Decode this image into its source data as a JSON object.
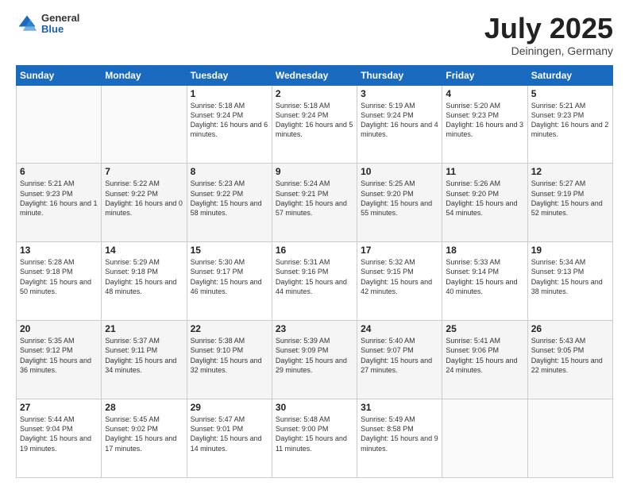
{
  "header": {
    "logo_general": "General",
    "logo_blue": "Blue",
    "month_title": "July 2025",
    "location": "Deiningen, Germany"
  },
  "days_of_week": [
    "Sunday",
    "Monday",
    "Tuesday",
    "Wednesday",
    "Thursday",
    "Friday",
    "Saturday"
  ],
  "weeks": [
    [
      {
        "day": "",
        "sunrise": "",
        "sunset": "",
        "daylight": ""
      },
      {
        "day": "",
        "sunrise": "",
        "sunset": "",
        "daylight": ""
      },
      {
        "day": "1",
        "sunrise": "Sunrise: 5:18 AM",
        "sunset": "Sunset: 9:24 PM",
        "daylight": "Daylight: 16 hours and 6 minutes."
      },
      {
        "day": "2",
        "sunrise": "Sunrise: 5:18 AM",
        "sunset": "Sunset: 9:24 PM",
        "daylight": "Daylight: 16 hours and 5 minutes."
      },
      {
        "day": "3",
        "sunrise": "Sunrise: 5:19 AM",
        "sunset": "Sunset: 9:24 PM",
        "daylight": "Daylight: 16 hours and 4 minutes."
      },
      {
        "day": "4",
        "sunrise": "Sunrise: 5:20 AM",
        "sunset": "Sunset: 9:23 PM",
        "daylight": "Daylight: 16 hours and 3 minutes."
      },
      {
        "day": "5",
        "sunrise": "Sunrise: 5:21 AM",
        "sunset": "Sunset: 9:23 PM",
        "daylight": "Daylight: 16 hours and 2 minutes."
      }
    ],
    [
      {
        "day": "6",
        "sunrise": "Sunrise: 5:21 AM",
        "sunset": "Sunset: 9:23 PM",
        "daylight": "Daylight: 16 hours and 1 minute."
      },
      {
        "day": "7",
        "sunrise": "Sunrise: 5:22 AM",
        "sunset": "Sunset: 9:22 PM",
        "daylight": "Daylight: 16 hours and 0 minutes."
      },
      {
        "day": "8",
        "sunrise": "Sunrise: 5:23 AM",
        "sunset": "Sunset: 9:22 PM",
        "daylight": "Daylight: 15 hours and 58 minutes."
      },
      {
        "day": "9",
        "sunrise": "Sunrise: 5:24 AM",
        "sunset": "Sunset: 9:21 PM",
        "daylight": "Daylight: 15 hours and 57 minutes."
      },
      {
        "day": "10",
        "sunrise": "Sunrise: 5:25 AM",
        "sunset": "Sunset: 9:20 PM",
        "daylight": "Daylight: 15 hours and 55 minutes."
      },
      {
        "day": "11",
        "sunrise": "Sunrise: 5:26 AM",
        "sunset": "Sunset: 9:20 PM",
        "daylight": "Daylight: 15 hours and 54 minutes."
      },
      {
        "day": "12",
        "sunrise": "Sunrise: 5:27 AM",
        "sunset": "Sunset: 9:19 PM",
        "daylight": "Daylight: 15 hours and 52 minutes."
      }
    ],
    [
      {
        "day": "13",
        "sunrise": "Sunrise: 5:28 AM",
        "sunset": "Sunset: 9:18 PM",
        "daylight": "Daylight: 15 hours and 50 minutes."
      },
      {
        "day": "14",
        "sunrise": "Sunrise: 5:29 AM",
        "sunset": "Sunset: 9:18 PM",
        "daylight": "Daylight: 15 hours and 48 minutes."
      },
      {
        "day": "15",
        "sunrise": "Sunrise: 5:30 AM",
        "sunset": "Sunset: 9:17 PM",
        "daylight": "Daylight: 15 hours and 46 minutes."
      },
      {
        "day": "16",
        "sunrise": "Sunrise: 5:31 AM",
        "sunset": "Sunset: 9:16 PM",
        "daylight": "Daylight: 15 hours and 44 minutes."
      },
      {
        "day": "17",
        "sunrise": "Sunrise: 5:32 AM",
        "sunset": "Sunset: 9:15 PM",
        "daylight": "Daylight: 15 hours and 42 minutes."
      },
      {
        "day": "18",
        "sunrise": "Sunrise: 5:33 AM",
        "sunset": "Sunset: 9:14 PM",
        "daylight": "Daylight: 15 hours and 40 minutes."
      },
      {
        "day": "19",
        "sunrise": "Sunrise: 5:34 AM",
        "sunset": "Sunset: 9:13 PM",
        "daylight": "Daylight: 15 hours and 38 minutes."
      }
    ],
    [
      {
        "day": "20",
        "sunrise": "Sunrise: 5:35 AM",
        "sunset": "Sunset: 9:12 PM",
        "daylight": "Daylight: 15 hours and 36 minutes."
      },
      {
        "day": "21",
        "sunrise": "Sunrise: 5:37 AM",
        "sunset": "Sunset: 9:11 PM",
        "daylight": "Daylight: 15 hours and 34 minutes."
      },
      {
        "day": "22",
        "sunrise": "Sunrise: 5:38 AM",
        "sunset": "Sunset: 9:10 PM",
        "daylight": "Daylight: 15 hours and 32 minutes."
      },
      {
        "day": "23",
        "sunrise": "Sunrise: 5:39 AM",
        "sunset": "Sunset: 9:09 PM",
        "daylight": "Daylight: 15 hours and 29 minutes."
      },
      {
        "day": "24",
        "sunrise": "Sunrise: 5:40 AM",
        "sunset": "Sunset: 9:07 PM",
        "daylight": "Daylight: 15 hours and 27 minutes."
      },
      {
        "day": "25",
        "sunrise": "Sunrise: 5:41 AM",
        "sunset": "Sunset: 9:06 PM",
        "daylight": "Daylight: 15 hours and 24 minutes."
      },
      {
        "day": "26",
        "sunrise": "Sunrise: 5:43 AM",
        "sunset": "Sunset: 9:05 PM",
        "daylight": "Daylight: 15 hours and 22 minutes."
      }
    ],
    [
      {
        "day": "27",
        "sunrise": "Sunrise: 5:44 AM",
        "sunset": "Sunset: 9:04 PM",
        "daylight": "Daylight: 15 hours and 19 minutes."
      },
      {
        "day": "28",
        "sunrise": "Sunrise: 5:45 AM",
        "sunset": "Sunset: 9:02 PM",
        "daylight": "Daylight: 15 hours and 17 minutes."
      },
      {
        "day": "29",
        "sunrise": "Sunrise: 5:47 AM",
        "sunset": "Sunset: 9:01 PM",
        "daylight": "Daylight: 15 hours and 14 minutes."
      },
      {
        "day": "30",
        "sunrise": "Sunrise: 5:48 AM",
        "sunset": "Sunset: 9:00 PM",
        "daylight": "Daylight: 15 hours and 11 minutes."
      },
      {
        "day": "31",
        "sunrise": "Sunrise: 5:49 AM",
        "sunset": "Sunset: 8:58 PM",
        "daylight": "Daylight: 15 hours and 9 minutes."
      },
      {
        "day": "",
        "sunrise": "",
        "sunset": "",
        "daylight": ""
      },
      {
        "day": "",
        "sunrise": "",
        "sunset": "",
        "daylight": ""
      }
    ]
  ]
}
